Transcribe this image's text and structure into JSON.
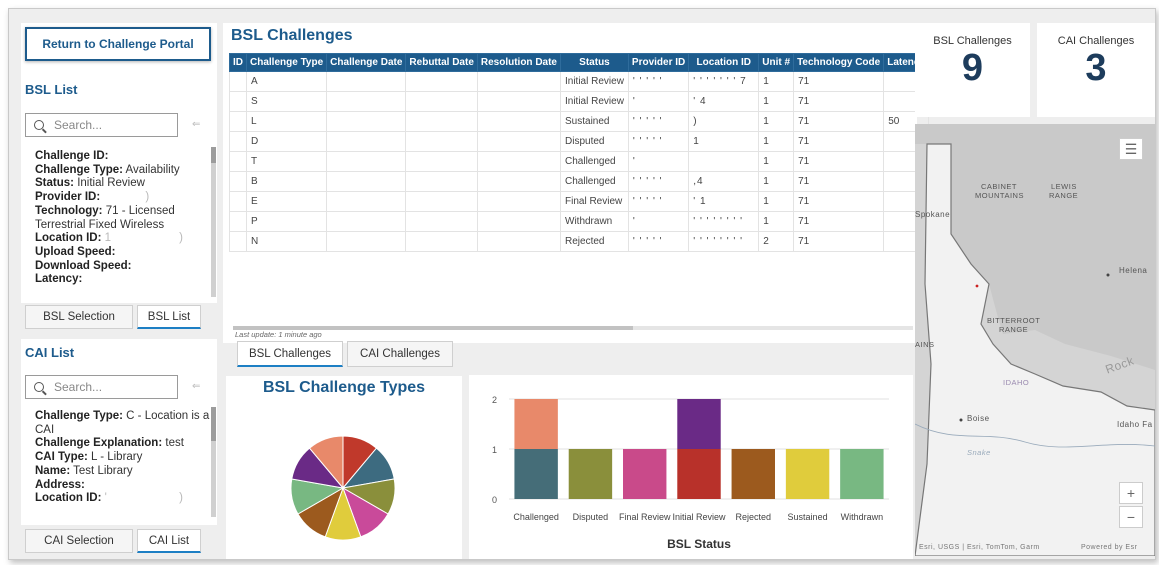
{
  "left": {
    "portal_button": "Return to Challenge Portal",
    "bsl_list_title": "BSL List",
    "search_placeholder": "Search...",
    "bsl_detail": {
      "challenge_id_label": "Challenge ID:",
      "challenge_type_label": "Challenge Type:",
      "challenge_type_value": "Availability",
      "status_label": "Status:",
      "status_value": "Initial Review",
      "provider_id_label": "Provider ID:",
      "provider_id_value": "          )",
      "technology_label": "Technology:",
      "technology_value": "71 - Licensed",
      "technology_value_2": "Terrestrial Fixed Wireless",
      "location_id_label": "Location ID:",
      "location_id_value": "1                )",
      "upload_label": "Upload Speed:",
      "download_label": "Download Speed:",
      "latency_label": "Latency:"
    },
    "bsl_tabs": [
      "BSL Selection",
      "BSL List"
    ],
    "cai_list_title": "CAI List",
    "cai_detail": {
      "challenge_type_label": "Challenge Type:",
      "challenge_type_value": "C - Location is a",
      "challenge_type_value_2": "CAI",
      "explanation_label": "Challenge Explanation:",
      "explanation_value": "test",
      "cai_type_label": "CAI Type:",
      "cai_type_value": "L - Library",
      "name_label": "Name:",
      "name_value": "Test Library",
      "address_label": "Address:",
      "location_id_label": "Location ID:",
      "location_id_value": "'                 )"
    },
    "cai_tabs": [
      "CAI Selection",
      "CAI List"
    ]
  },
  "main": {
    "title": "BSL Challenges",
    "columns": [
      "ID",
      "Challenge Type",
      "Challenge Date",
      "Rebuttal Date",
      "Resolution Date",
      "Status",
      "Provider ID",
      "Location ID",
      "Unit #",
      "Technology Code",
      "Latency"
    ],
    "rows": [
      {
        "type": "A",
        "status": "Initial Review",
        "provider": "' ' ' ' '",
        "location": "' ' ' ' ' ' ' 7",
        "unit": "1",
        "tech": "71",
        "latency": ""
      },
      {
        "type": "S",
        "status": "Initial Review",
        "provider": "'",
        "location": "' 4",
        "unit": "1",
        "tech": "71",
        "latency": ""
      },
      {
        "type": "L",
        "status": "Sustained",
        "provider": "' ' ' ' '",
        "location": ")",
        "unit": "1",
        "tech": "71",
        "latency": "50"
      },
      {
        "type": "D",
        "status": "Disputed",
        "provider": "' ' ' ' '",
        "location": "1",
        "unit": "1",
        "tech": "71",
        "latency": ""
      },
      {
        "type": "T",
        "status": "Challenged",
        "provider": "'",
        "location": "",
        "unit": "1",
        "tech": "71",
        "latency": ""
      },
      {
        "type": "B",
        "status": "Challenged",
        "provider": "' ' ' ' '",
        "location": ",4",
        "unit": "1",
        "tech": "71",
        "latency": ""
      },
      {
        "type": "E",
        "status": "Final Review",
        "provider": "' ' ' ' '",
        "location": "' 1",
        "unit": "1",
        "tech": "71",
        "latency": ""
      },
      {
        "type": "P",
        "status": "Withdrawn",
        "provider": "'",
        "location": "' ' ' ' ' ' ' '",
        "unit": "1",
        "tech": "71",
        "latency": ""
      },
      {
        "type": "N",
        "status": "Rejected",
        "provider": "' ' ' ' '",
        "location": "' ' ' ' ' ' ' '",
        "unit": "2",
        "tech": "71",
        "latency": ""
      }
    ],
    "last_update": "Last update: 1 minute ago",
    "tabs": [
      "BSL Challenges",
      "CAI Challenges"
    ]
  },
  "stats": {
    "bsl_label": "BSL Challenges",
    "bsl_value": "9",
    "cai_label": "CAI Challenges",
    "cai_value": "3"
  },
  "pie_title": "BSL Challenge Types",
  "bar_xlabel": "BSL Status",
  "chart_data": [
    {
      "type": "pie",
      "title": "BSL Challenge Types",
      "slices": [
        {
          "label": "",
          "value": 1,
          "color": "#c0392b"
        },
        {
          "label": "",
          "value": 1,
          "color": "#3d6b80"
        },
        {
          "label": "",
          "value": 1,
          "color": "#8a8f3b"
        },
        {
          "label": "",
          "value": 1,
          "color": "#c94a9a"
        },
        {
          "label": "",
          "value": 1,
          "color": "#e0cc3c"
        },
        {
          "label": "",
          "value": 1,
          "color": "#9c5a1e"
        },
        {
          "label": "",
          "value": 1,
          "color": "#78b882"
        },
        {
          "label": "",
          "value": 1,
          "color": "#6a2a86"
        },
        {
          "label": "",
          "value": 1,
          "color": "#e8896a"
        }
      ]
    },
    {
      "type": "bar",
      "stacked": true,
      "xlabel": "BSL Status",
      "categories": [
        "Challenged",
        "Disputed",
        "Final Review",
        "Initial Review",
        "Rejected",
        "Sustained",
        "Withdrawn"
      ],
      "ylim": [
        0,
        2
      ],
      "yticks": [
        0,
        1,
        2
      ],
      "stacks": [
        [
          {
            "value": 1,
            "color": "#456d78"
          },
          {
            "value": 1,
            "color": "#e8896a"
          }
        ],
        [
          {
            "value": 1,
            "color": "#8a8f3b"
          }
        ],
        [
          {
            "value": 1,
            "color": "#c94a8a"
          }
        ],
        [
          {
            "value": 1,
            "color": "#b8312a"
          },
          {
            "value": 1,
            "color": "#6a2a86"
          }
        ],
        [
          {
            "value": 1,
            "color": "#9c5a1e"
          }
        ],
        [
          {
            "value": 1,
            "color": "#e0cc3c"
          }
        ],
        [
          {
            "value": 1,
            "color": "#78b882"
          }
        ]
      ]
    }
  ],
  "map": {
    "labels": [
      "Spokane",
      "CABINET",
      "MOUNTAINS",
      "LEWIS",
      "RANGE",
      "Helena",
      "BITTERROOT",
      "RANGE",
      "AINS",
      "IDAHO",
      "Boise",
      "Idaho Fa",
      "Snake",
      "Rock",
      "Esri, USGS | Esri, TomTom, Garm",
      "Powered by Esr"
    ],
    "zoom_in": "+",
    "zoom_out": "−",
    "layers_icon": "list-icon"
  }
}
